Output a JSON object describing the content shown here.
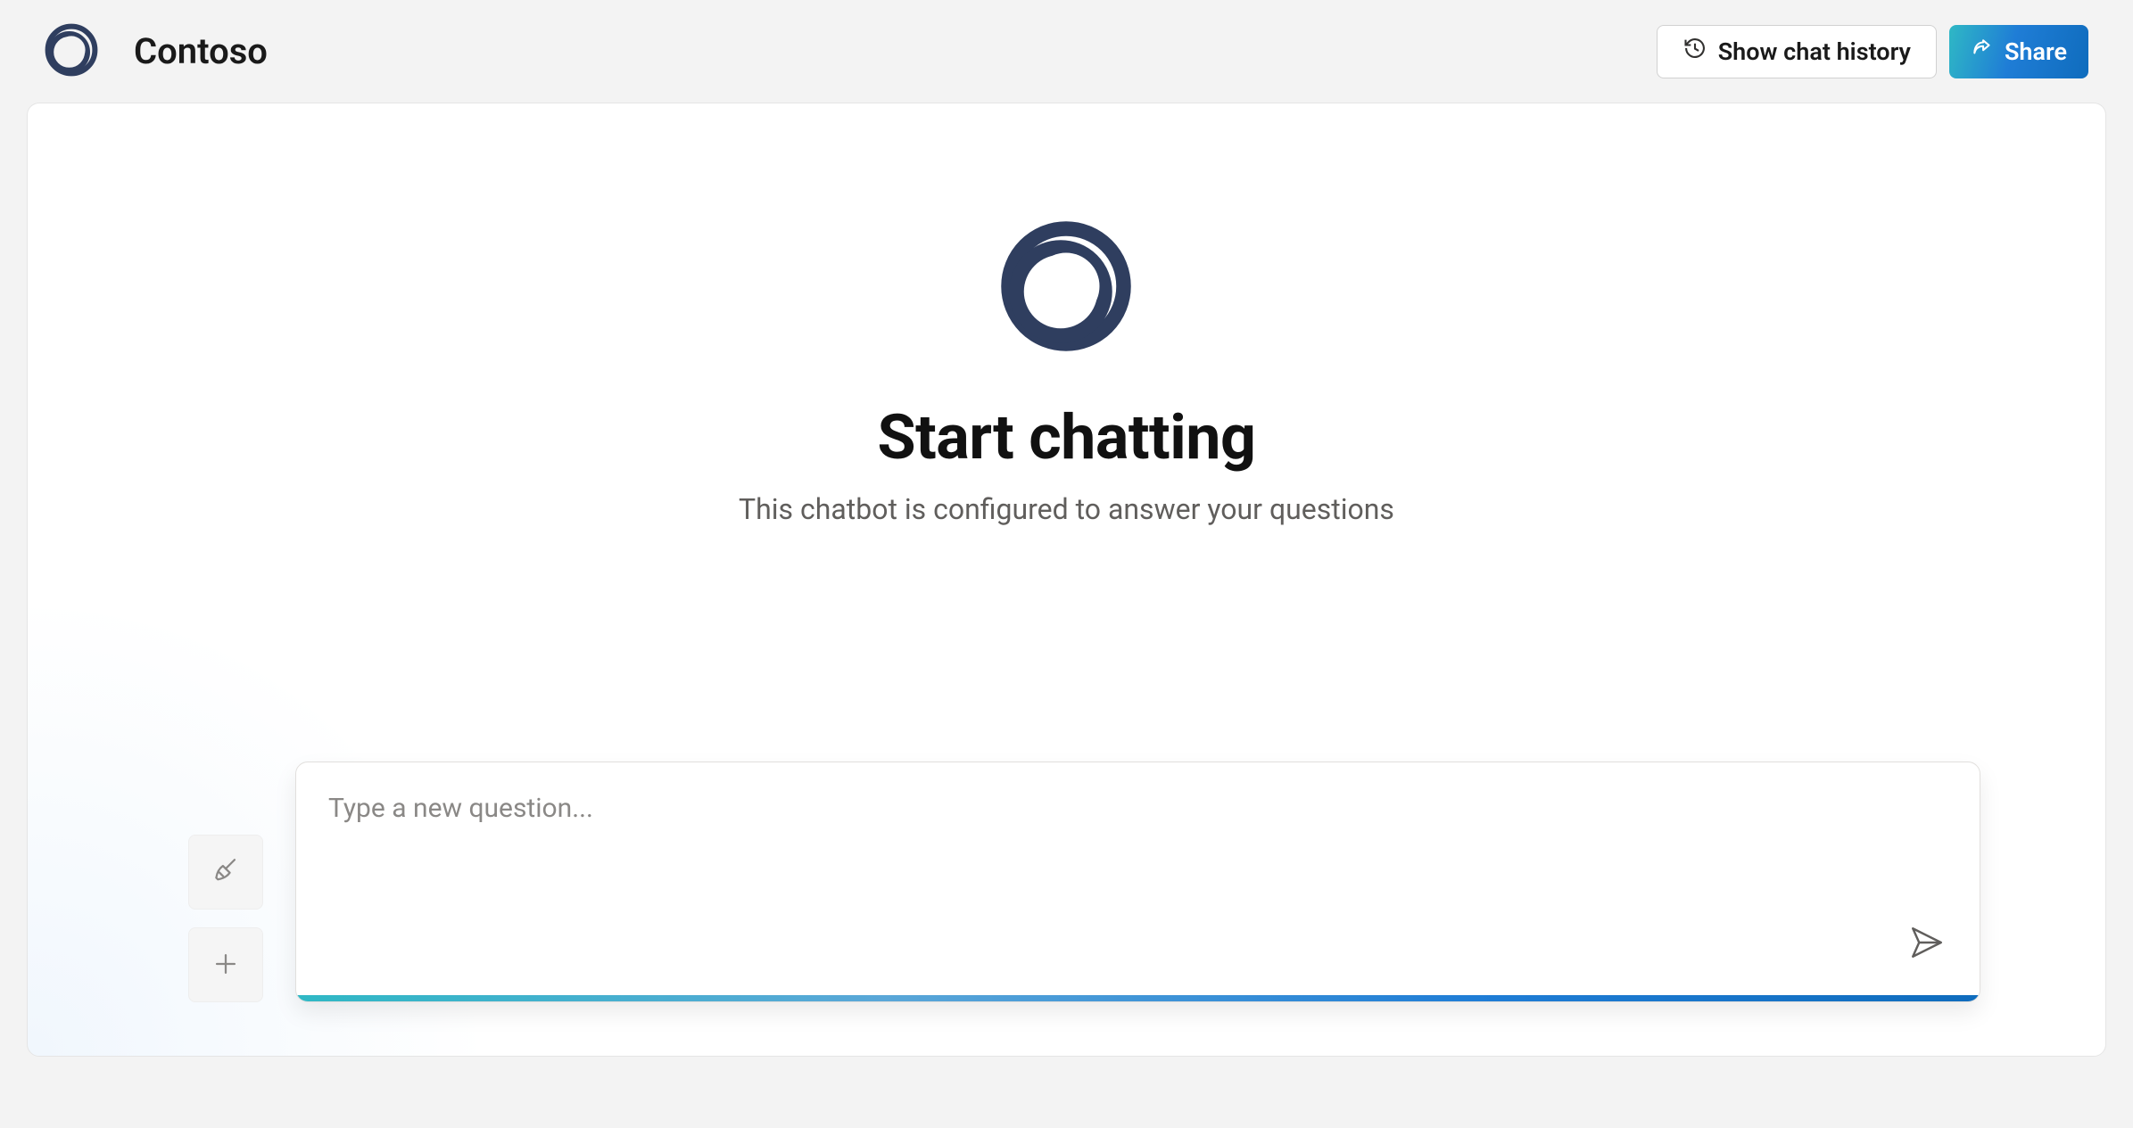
{
  "header": {
    "brand": "Contoso",
    "show_history_label": "Show chat history",
    "share_label": "Share"
  },
  "hero": {
    "title": "Start chatting",
    "subtitle": "This chatbot is configured to answer your questions"
  },
  "composer": {
    "placeholder": "Type a new question..."
  },
  "colors": {
    "brand_navy": "#2f3e5f",
    "gradient_start": "#2fb8c5",
    "gradient_end": "#0f6cbd"
  }
}
